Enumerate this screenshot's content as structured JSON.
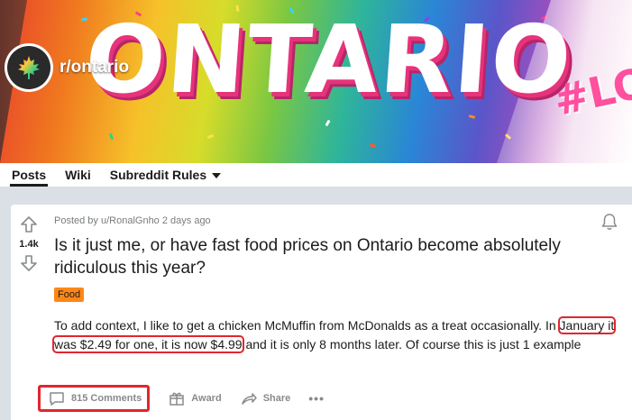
{
  "banner": {
    "word": "ONTARIO",
    "tag": "#LOV"
  },
  "subreddit": {
    "name": "r/ontario",
    "avatar_icon": "maple-leaf-icon"
  },
  "tabs": [
    {
      "label": "Posts",
      "active": true
    },
    {
      "label": "Wiki",
      "active": false
    },
    {
      "label": "Subreddit Rules",
      "active": false
    }
  ],
  "post": {
    "meta": "Posted by u/RonalGnho 2 days ago",
    "score": "1.4k",
    "title": "Is it just me, or have fast food prices on Ontario become absolutely ridiculous this year?",
    "flair": "Food",
    "body_before": "To add context, I like to get a chicken McMuffin from McDonalds as a treat occasionally. In ",
    "body_highlight": "January it was $2.49 for one, it is now $4.99",
    "body_after": " and it is only 8 months later. Of course this is just 1 example",
    "actions": {
      "comments": "815 Comments",
      "award": "Award",
      "share": "Share",
      "more": "•••"
    }
  },
  "colors": {
    "highlight_outline": "#e0262e",
    "flair_bg": "#ff8717",
    "page_bg": "#dae0e6"
  }
}
